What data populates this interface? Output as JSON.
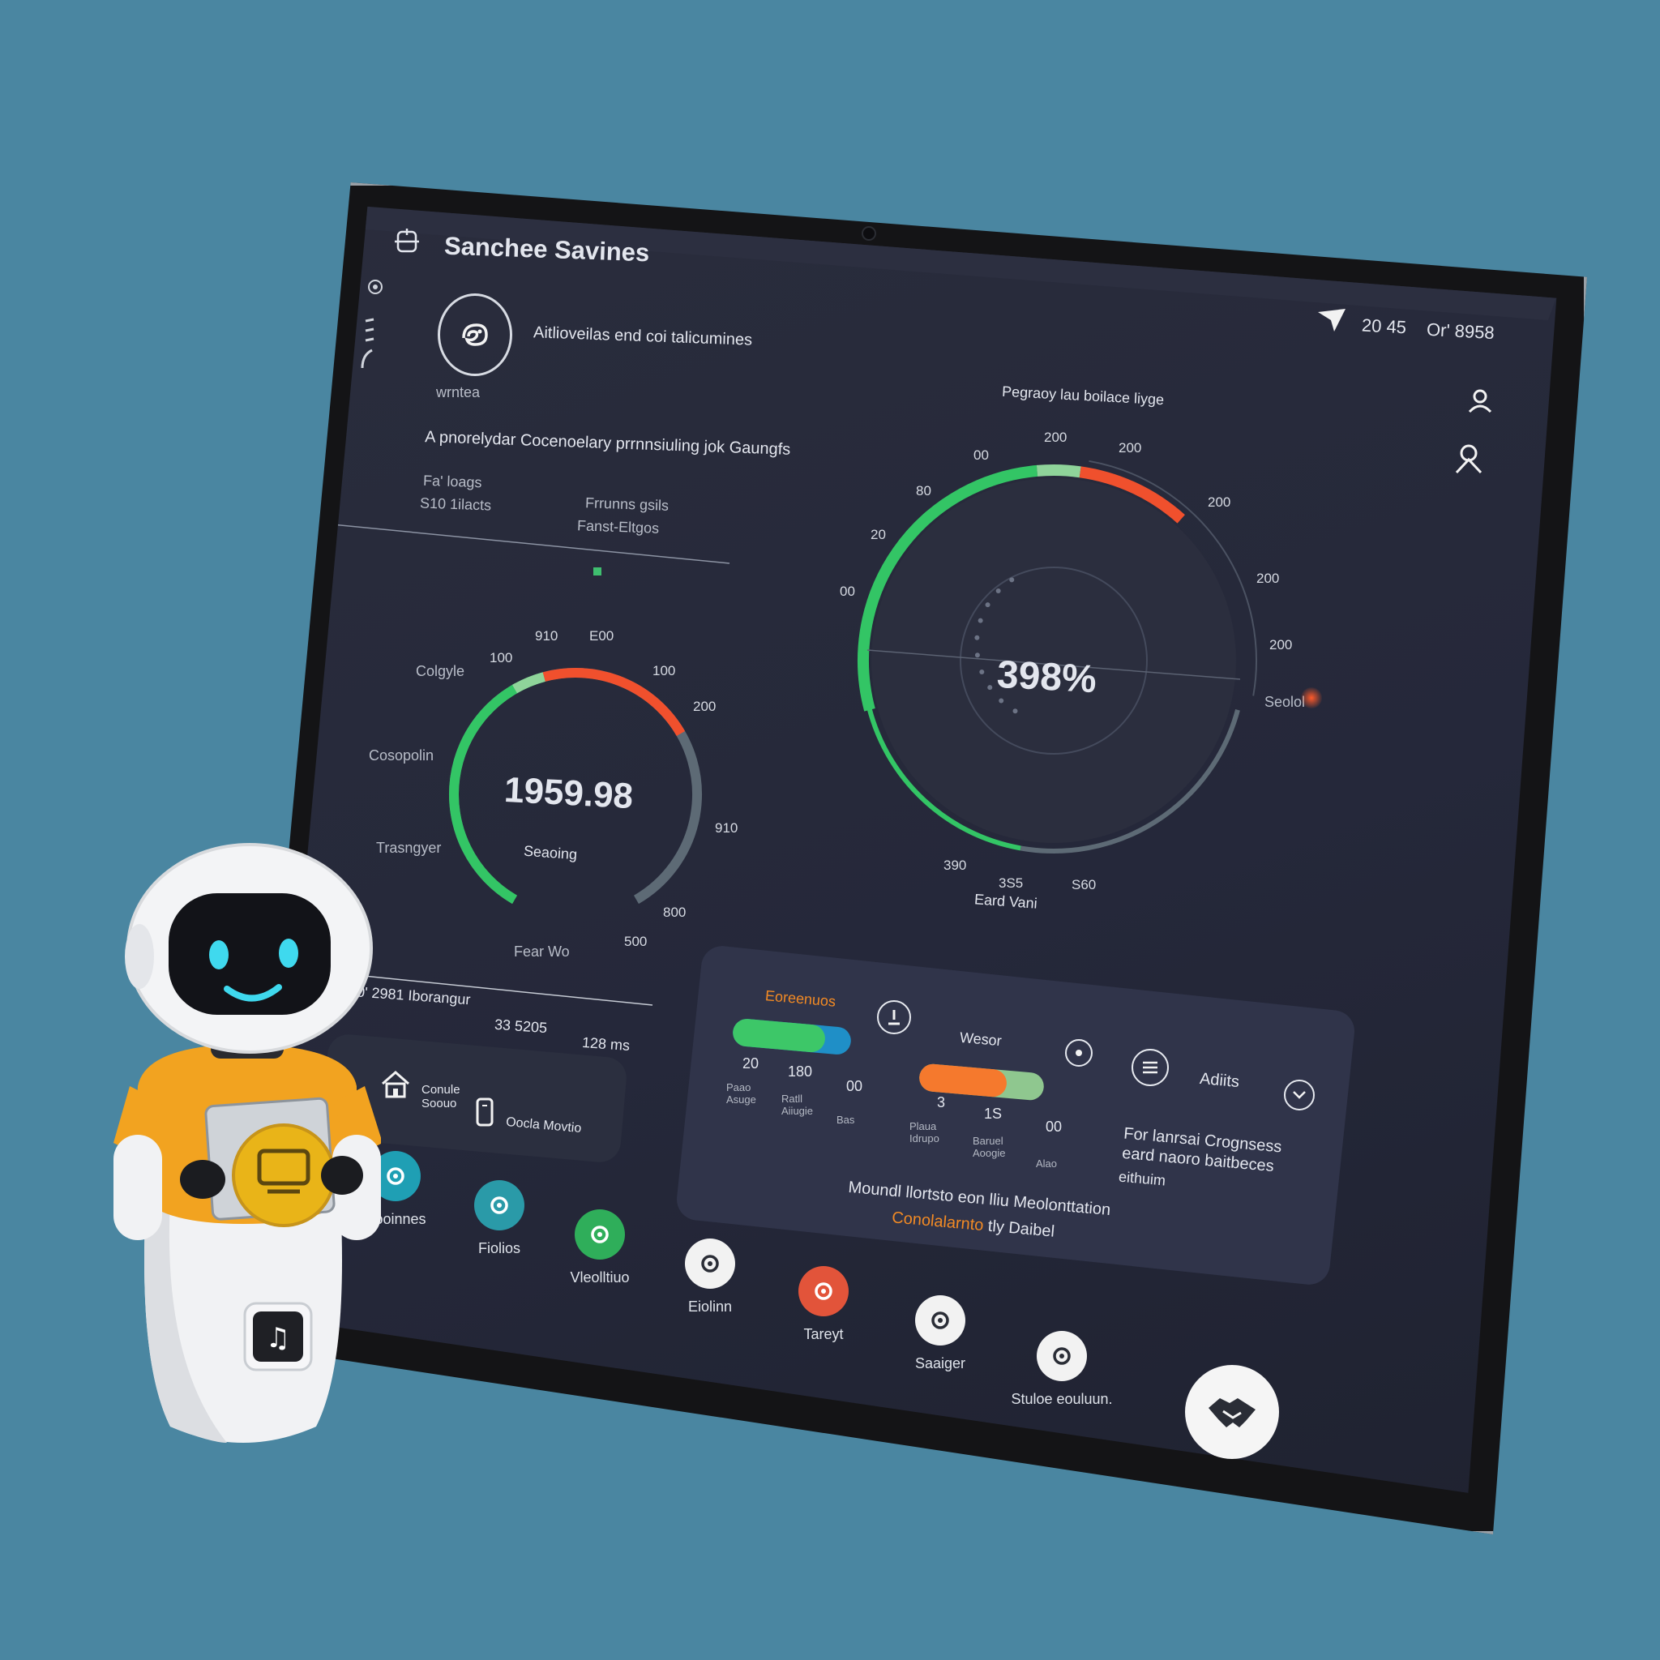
{
  "app": {
    "title": "Sanchee Savines",
    "status_time": "20 45",
    "status_date": "Or' 8958"
  },
  "profile": {
    "caption": "Aitlioveilas end coi talicumines",
    "avatar_label": "wrntea"
  },
  "summary": {
    "heading": "A pnorelydar Cocenoelary prrnnsiuling jok Gaungfs",
    "row1_left": "Fa' loags",
    "row2_left": "S10 1ilacts",
    "row1_right": "Frrunns gsils",
    "row2_right": "Fanst-Eltgos"
  },
  "gauge_small": {
    "value": "1959.98",
    "sublabel": "Seaoing",
    "green_fraction": 0.45,
    "red_fraction": 0.25,
    "ticks": [
      "910",
      "E00",
      "100",
      "200",
      "100",
      "910",
      "800",
      "500"
    ],
    "labels": [
      "Colgyle",
      "Cosopolin",
      "Trasngyer",
      "Fear Wo"
    ]
  },
  "gauge_large": {
    "title": "Pegraoy lau boilace liyge",
    "value": "398%",
    "bottom_label": "Eard Vani",
    "side_label": "Seolol",
    "ticks": [
      "00",
      "200",
      "200",
      "200",
      "200",
      "200",
      "80",
      "20",
      "00",
      "390",
      "3S5",
      "S60"
    ]
  },
  "card": {
    "left_text": "S0' 2981 Iborangur",
    "mid_value": "33 5205",
    "right_value": "128 ms"
  },
  "quick": {
    "item1": "Conule Soouo",
    "item2": "Oocla Movtio"
  },
  "lower_panel": {
    "title": "Eoreenuos",
    "mid_title": "Wesor",
    "right_title": "Adiits",
    "bar1": {
      "value_fraction": 0.78,
      "nums": [
        "20",
        "180",
        "00"
      ],
      "labels": [
        "Paao Asuge",
        "Ratll Aiiugie",
        "Bas"
      ]
    },
    "bar2": {
      "value_fraction": 0.7,
      "nums": [
        "3",
        "1S",
        "00"
      ],
      "labels": [
        "Plaua Idrupo",
        "Baruel Aoogie",
        "Alao"
      ]
    },
    "right_text_1": "For lanrsai Crognsess",
    "right_text_2": "eard naoro baitbeces",
    "right_text_3": "eithuim",
    "footer_1": "Moundl llortsto eon lliu Meolonttation",
    "footer_2_accent": "Conolalarnto",
    "footer_2_rest": "tly Daibel"
  },
  "dock": [
    {
      "label": "Eooinnes",
      "icon": "search-icon",
      "color": "#1f9fb4"
    },
    {
      "label": "Fiolios",
      "icon": "target-icon",
      "color": "#2a9aa8"
    },
    {
      "label": "Vleolltiuo",
      "icon": "spiral-icon",
      "color": "#2fae5a"
    },
    {
      "label": "Eiolinn",
      "icon": "printer-icon",
      "color": "#f2f2f2"
    },
    {
      "label": "Tareyt",
      "icon": "chat-bubble-icon",
      "color": "#e2543a"
    },
    {
      "label": "Saaiger",
      "icon": "gear-icon",
      "color": "#f2f2f2"
    },
    {
      "label": "Stuloe eouluun.",
      "icon": "refresh-arrow-icon",
      "color": "#f2f2f2"
    }
  ],
  "colors": {
    "green": "#33c565",
    "red": "#f0502d",
    "orange": "#f57c2c",
    "accent_text": "#f28a24",
    "gray_arc": "#5d6a75"
  }
}
